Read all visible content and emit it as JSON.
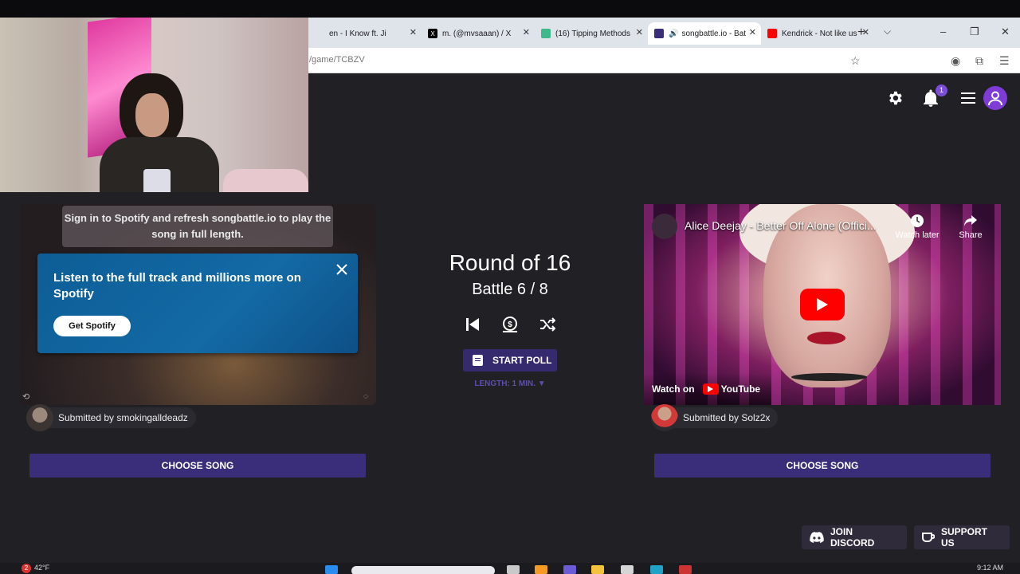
{
  "browser": {
    "tabs": [
      {
        "label": "en - I Know ft. Ji",
        "favicon": "music-note-icon",
        "active": false
      },
      {
        "label": "m. (@mvsaaan) / X",
        "favicon": "x-logo-icon",
        "active": false
      },
      {
        "label": "(16) Tipping Methods",
        "favicon": "twitch-icon",
        "active": false
      },
      {
        "label": "songbattle.io - Bat",
        "favicon": "songbattle-icon",
        "active": true
      },
      {
        "label": "Kendrick - Not like us",
        "favicon": "youtube-icon",
        "active": false
      }
    ],
    "url": "/game/TCBZV"
  },
  "header": {
    "notification_count": "1"
  },
  "left": {
    "spotify_signin": "Sign in to Spotify and refresh songbattle.io to play the song in full length.",
    "spotify_card_message": "Listen to the full track and millions more on Spotify",
    "get_spotify": "Get Spotify",
    "submitted_by": "Submitted by smokingalldeadz",
    "choose_song": "CHOOSE SONG"
  },
  "center": {
    "round": "Round of 16",
    "battle": "Battle 6 / 8",
    "start_poll": "START POLL",
    "length": "LENGTH: 1 MIN. ▼"
  },
  "right": {
    "video_title": "Alice Deejay - Better Off Alone (Offici...",
    "watch_later": "Watch later",
    "share": "Share",
    "watch_on": "Watch on",
    "youtube": "YouTube",
    "submitted_by": "Submitted by Solz2x",
    "choose_song": "CHOOSE SONG"
  },
  "footer": {
    "join_discord": "JOIN DISCORD",
    "support_us": "SUPPORT US"
  },
  "taskbar": {
    "weather": "42°F",
    "badge": "2",
    "time": "9:12 AM"
  },
  "colors": {
    "page_bg": "#212025",
    "accent_purple": "#3a2d7a",
    "spotify_blue": "#136aa5",
    "youtube_red": "#ff0000"
  }
}
